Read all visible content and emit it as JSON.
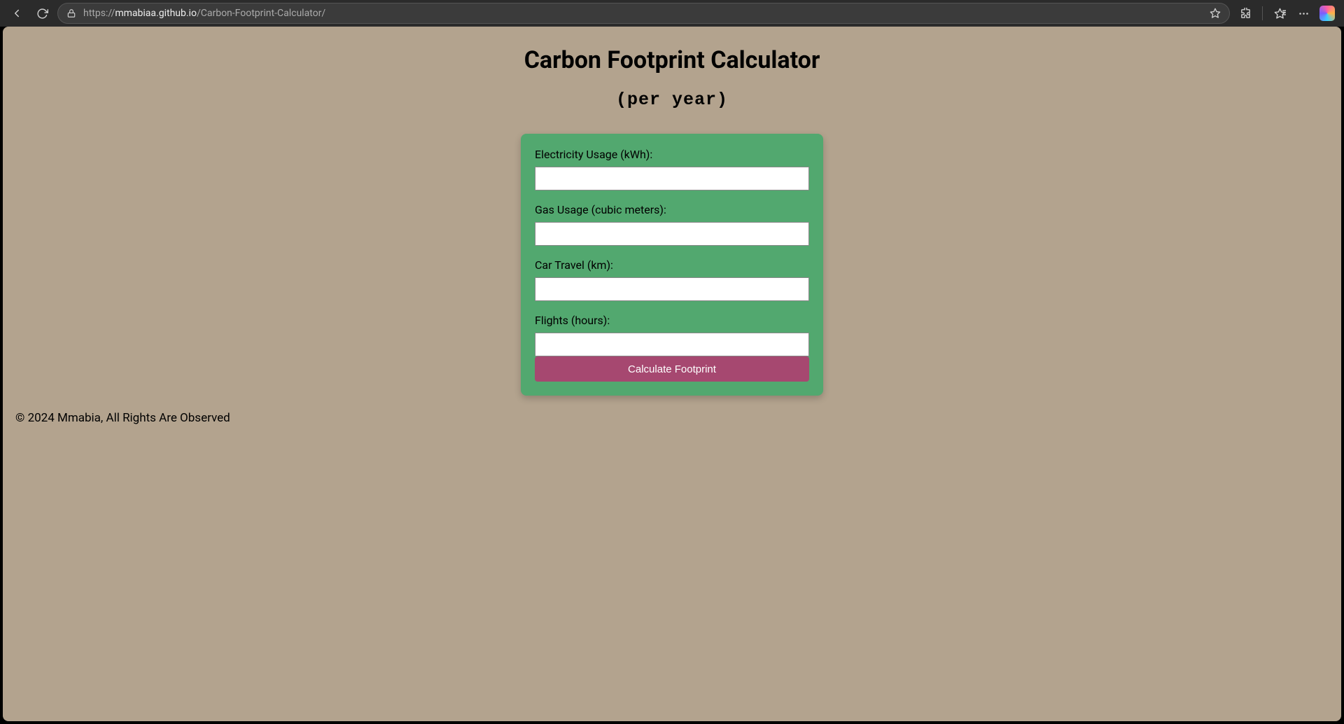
{
  "browser": {
    "url_host": "mmabiaa.github.io",
    "url_path": "/Carbon-Footprint-Calculator/",
    "url_scheme": "https://"
  },
  "page": {
    "title": "Carbon Footprint Calculator",
    "subtitle": "(per year)"
  },
  "form": {
    "fields": [
      {
        "label": "Electricity Usage (kWh):",
        "value": ""
      },
      {
        "label": "Gas Usage (cubic meters):",
        "value": ""
      },
      {
        "label": "Car Travel (km):",
        "value": ""
      },
      {
        "label": "Flights (hours):",
        "value": ""
      }
    ],
    "submit_label": "Calculate Footprint"
  },
  "footer": {
    "text": "© 2024 Mmabia, All Rights Are Observed"
  }
}
